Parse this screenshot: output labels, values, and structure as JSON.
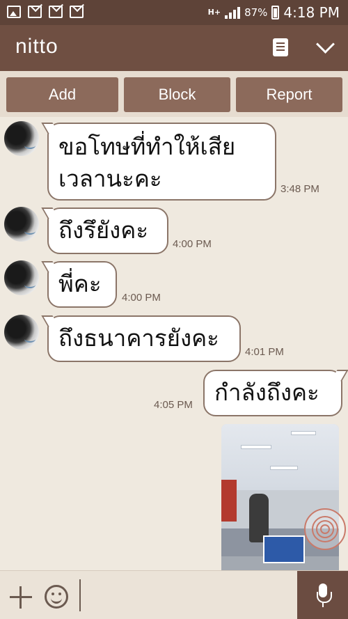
{
  "status_bar": {
    "battery": "87%",
    "time": "4:18 PM",
    "network": "H+",
    "left_icons": [
      "gallery-icon",
      "missed-message-icon",
      "gmail-icon",
      "missed-message-icon"
    ]
  },
  "header": {
    "title": "nitto",
    "right_icons": [
      "note-icon",
      "chevron-down-icon"
    ]
  },
  "actions": {
    "add_label": "Add",
    "block_label": "Block",
    "report_label": "Report"
  },
  "messages": [
    {
      "direction": "in",
      "lines": [
        "ขอโทษที่ทำให้เสีย",
        "เวลานะคะ"
      ],
      "time": "3:48 PM"
    },
    {
      "direction": "in",
      "lines": [
        "ถึงรึยังคะ"
      ],
      "time": "4:00 PM"
    },
    {
      "direction": "in",
      "lines": [
        "พี่คะ"
      ],
      "time": "4:00 PM"
    },
    {
      "direction": "in",
      "lines": [
        "ถึงธนาคารยังคะ"
      ],
      "time": "4:01 PM"
    },
    {
      "direction": "out",
      "lines": [
        "กำลังถึงคะ"
      ],
      "time": "4:05 PM"
    }
  ],
  "composer": {
    "placeholder": ""
  },
  "colors": {
    "header": "#6f4f42",
    "status_bar": "#5e4338",
    "action_button": "#8c6a5b",
    "background": "#efe9df",
    "bubble_border": "#8b7568"
  }
}
